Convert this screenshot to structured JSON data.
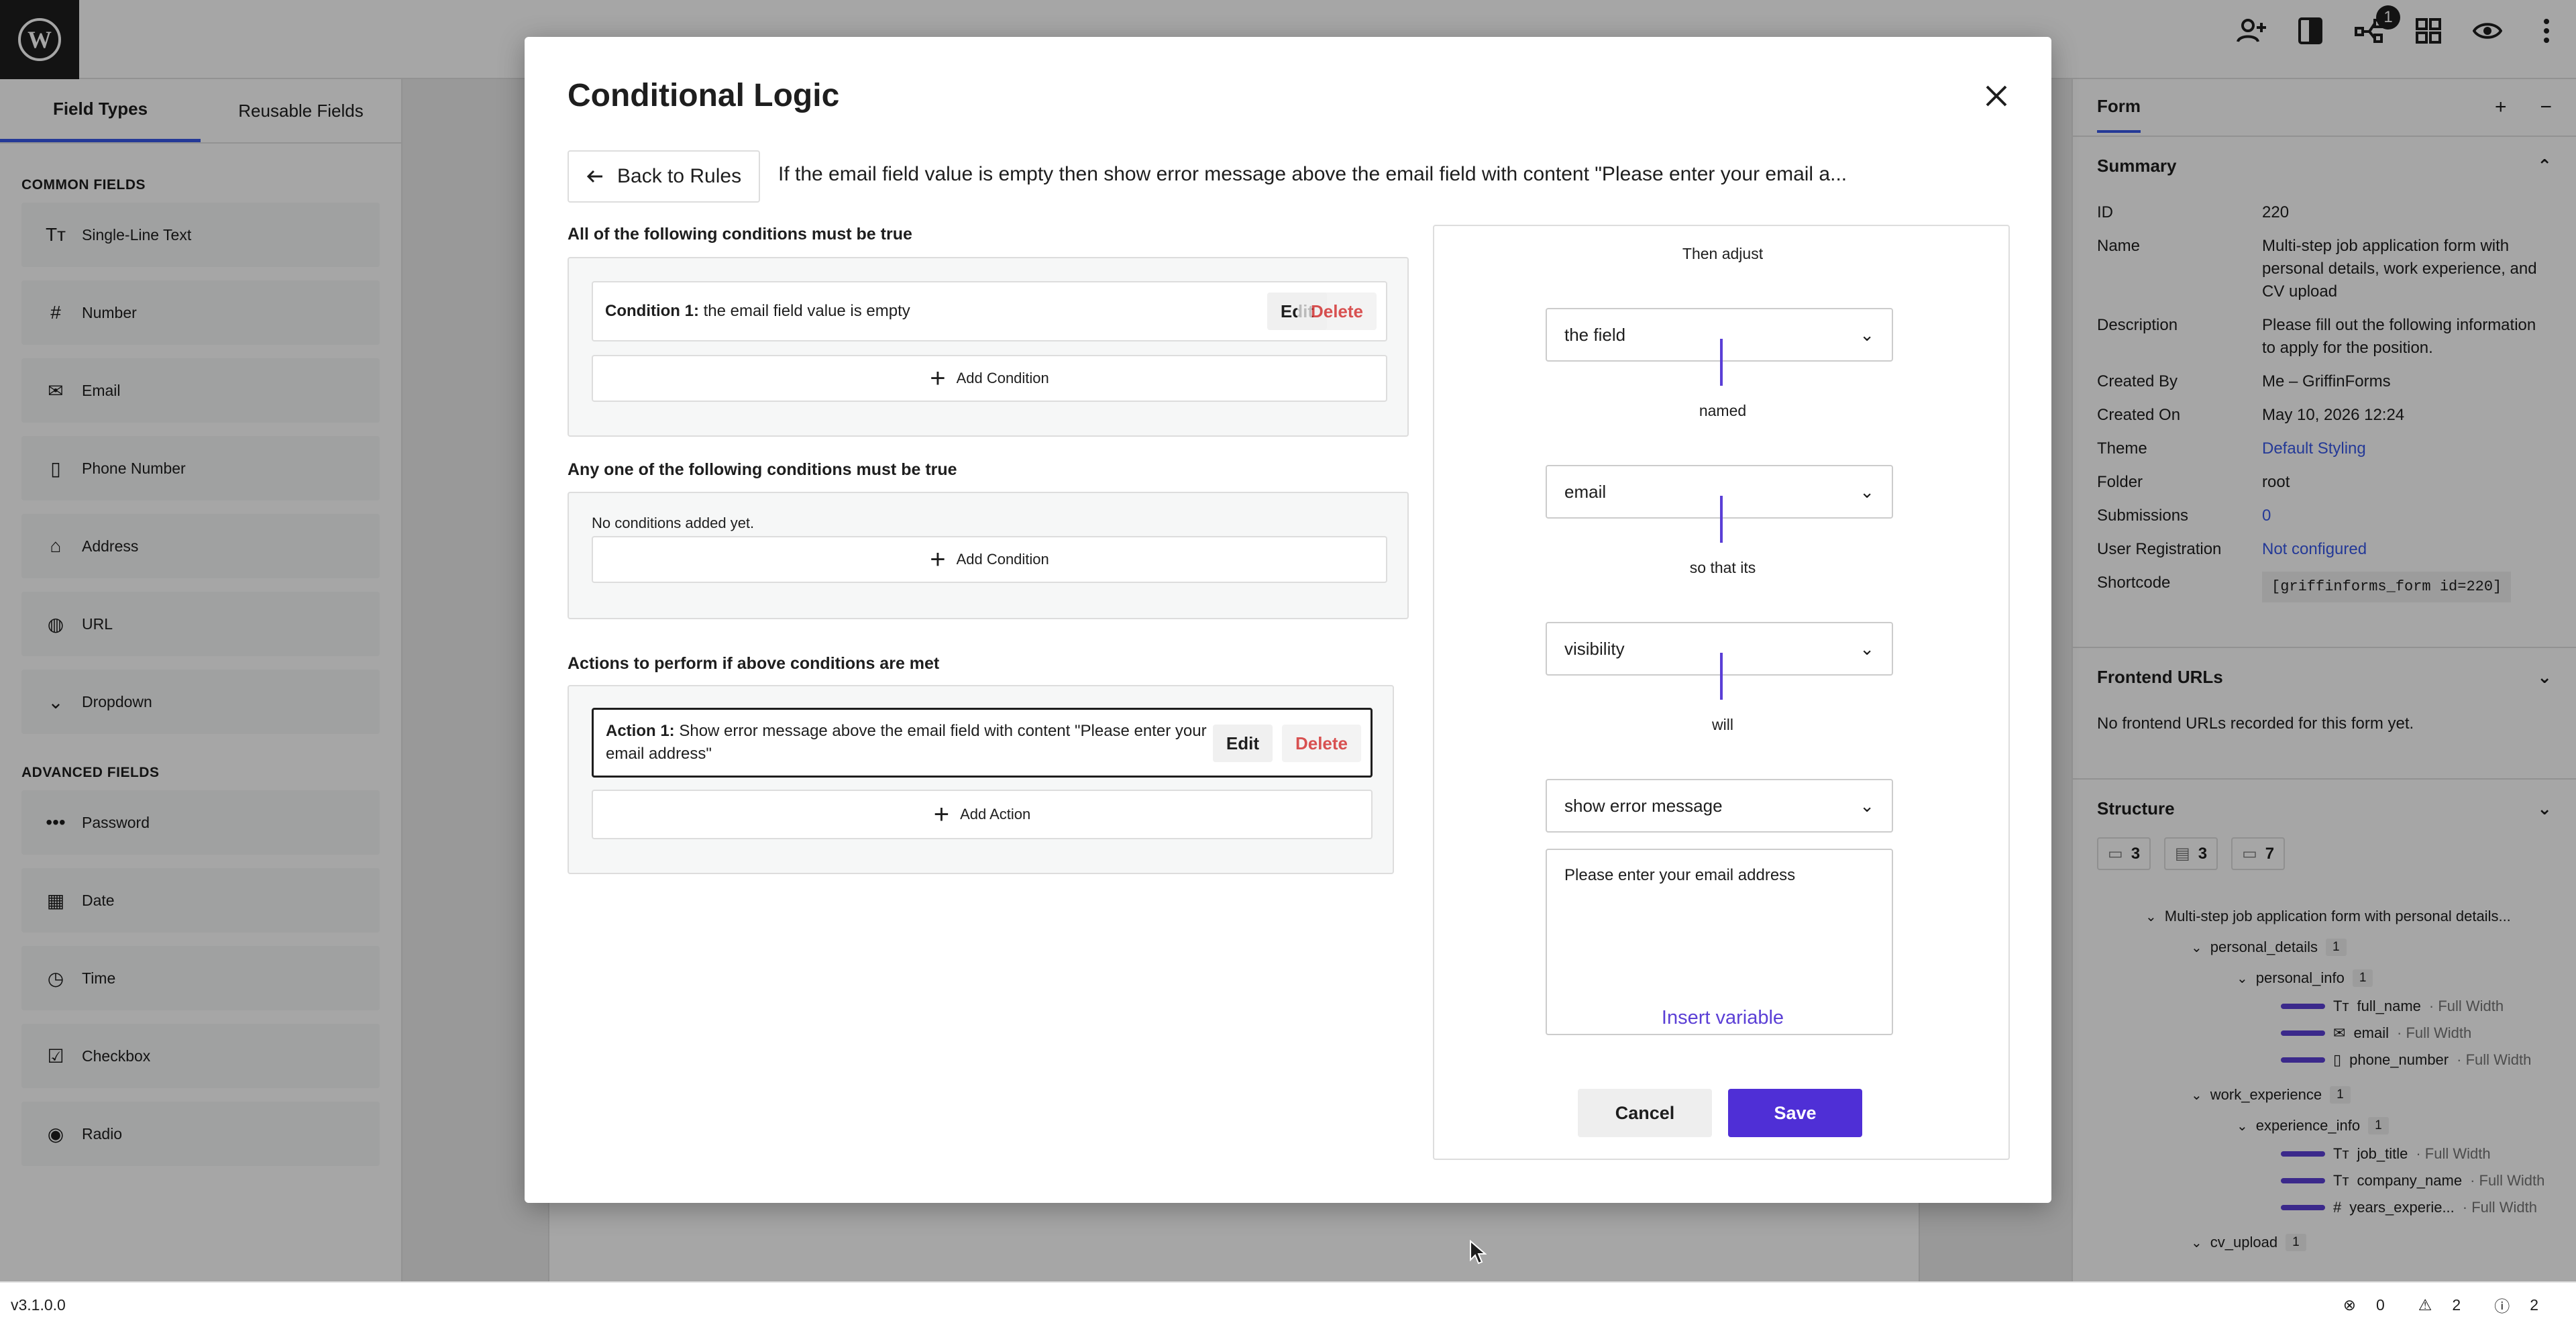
{
  "topbar": {
    "logo": "wordpress-logo",
    "icons": [
      "collaborators-icon",
      "styles-icon",
      "connections-icon",
      "blocks-icon",
      "preview-icon",
      "more-icon"
    ],
    "notification_count": "1"
  },
  "left_panel": {
    "tabs": [
      "Field Types",
      "Reusable Fields"
    ],
    "common_heading": "COMMON FIELDS",
    "common_fields": [
      {
        "label": "Single-Line Text",
        "icon": "Tт"
      },
      {
        "label": "Number",
        "icon": "#"
      },
      {
        "label": "Email",
        "icon": "✉"
      },
      {
        "label": "Phone Number",
        "icon": "▯"
      },
      {
        "label": "Address",
        "icon": "⌂"
      },
      {
        "label": "URL",
        "icon": "◍"
      },
      {
        "label": "Dropdown",
        "icon": "⌄"
      }
    ],
    "advanced_heading": "ADVANCED FIELDS",
    "advanced_fields": [
      {
        "label": "Password",
        "icon": "•••"
      },
      {
        "label": "Date",
        "icon": "▦"
      },
      {
        "label": "Time",
        "icon": "◷"
      },
      {
        "label": "Checkbox",
        "icon": "☑"
      },
      {
        "label": "Radio",
        "icon": "◉"
      }
    ]
  },
  "right_panel": {
    "header": "Form",
    "summary_title": "Summary",
    "summary": [
      {
        "k": "ID",
        "v": "220"
      },
      {
        "k": "Name",
        "v": "Multi-step job application form with personal details, work experience, and CV upload"
      },
      {
        "k": "Description",
        "v": "Please fill out the following information to apply for the position."
      },
      {
        "k": "Created By",
        "v": "Me – GriffinForms"
      },
      {
        "k": "Created On",
        "v": "May 10, 2026 12:24"
      },
      {
        "k": "Theme",
        "v": "Default Styling"
      },
      {
        "k": "Folder",
        "v": "root"
      },
      {
        "k": "Submissions",
        "v": "0"
      },
      {
        "k": "User Registration",
        "v": "Not configured"
      },
      {
        "k": "Shortcode",
        "v": "[griffinforms_form id=220]"
      }
    ],
    "frontend_title": "Frontend URLs",
    "frontend_empty": "No frontend URLs recorded for this form yet.",
    "structure_title": "Structure",
    "structure_counts": [
      "3",
      "3",
      "7"
    ],
    "tree": {
      "root": "Multi-step job application form with personal details...",
      "pages": [
        {
          "name": "personal_details",
          "count": "1",
          "section": "personal_info",
          "section_count": "1",
          "fields": [
            {
              "icon": "Tт",
              "name": "full_name",
              "width": "· Full Width"
            },
            {
              "icon": "✉",
              "name": "email",
              "width": "· Full Width"
            },
            {
              "icon": "▯",
              "name": "phone_number",
              "width": "· Full Width"
            }
          ]
        },
        {
          "name": "work_experience",
          "count": "1",
          "section": "experience_info",
          "section_count": "1",
          "fields": [
            {
              "icon": "Tт",
              "name": "job_title",
              "width": "· Full Width"
            },
            {
              "icon": "Tт",
              "name": "company_name",
              "width": "· Full Width"
            },
            {
              "icon": "#",
              "name": "years_experie...",
              "width": "· Full Width"
            }
          ]
        },
        {
          "name": "cv_upload",
          "count": "1"
        }
      ]
    }
  },
  "statusbar": {
    "version": "v3.1.0.0",
    "errors": "0",
    "warnings": "2",
    "info": "2"
  },
  "modal": {
    "title": "Conditional Logic",
    "back_label": "Back to Rules",
    "rule_summary": "If the email field value is empty then show error message above the email field with content \"Please enter your email a...",
    "all_label": "All of the following conditions must be true",
    "all_conditions": [
      {
        "prefix": "Condition 1:",
        "text": " the email field value is empty",
        "edit": "Edit",
        "delete": "Delete"
      }
    ],
    "any_label": "Any one of the following conditions must be true",
    "any_empty": "No conditions added yet.",
    "add_condition": "Add Condition",
    "actions_label": "Actions to perform if above conditions are met",
    "actions": [
      {
        "prefix": "Action 1:",
        "text": " Show error message above the email field with content \"Please enter your email address\"",
        "edit": "Edit",
        "delete": "Delete"
      }
    ],
    "add_action": "Add Action",
    "builder": {
      "then_adjust": "Then adjust",
      "target": "the field",
      "named": "named",
      "field": "email",
      "so_that_its": "so that its",
      "property": "visibility",
      "will": "will",
      "effect": "show error message",
      "message": "Please enter your email address",
      "insert_variable": "Insert variable",
      "cancel": "Cancel",
      "save": "Save"
    }
  },
  "colors": {
    "accent": "#3858e9",
    "primary_button": "#4f2fd6",
    "connector": "#5b3fd6",
    "delete": "#cc1818"
  }
}
